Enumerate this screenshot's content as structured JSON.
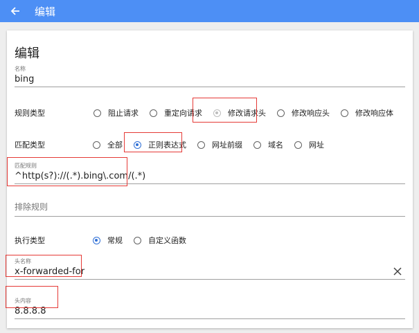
{
  "appbar": {
    "title": "编辑"
  },
  "card": {
    "title": "编辑",
    "name": {
      "label": "名称",
      "value": "bing"
    },
    "rule_type": {
      "label": "规则类型",
      "options": [
        "阻止请求",
        "重定向请求",
        "修改请求头",
        "修改响应头",
        "修改响应体"
      ],
      "selected": "修改请求头"
    },
    "match_type": {
      "label": "匹配类型",
      "options": [
        "全部",
        "正则表达式",
        "网址前缀",
        "域名",
        "网址"
      ],
      "selected": "正则表达式"
    },
    "match_rule": {
      "label": "匹配规则",
      "value": "^http(s?)://(.*).bing\\.com/(.*)"
    },
    "exclude_rule": {
      "placeholder": "排除规则"
    },
    "exec_type": {
      "label": "执行类型",
      "options": [
        "常规",
        "自定义函数"
      ],
      "selected": "常规"
    },
    "header_name": {
      "label": "头名称",
      "value": "x-forwarded-for"
    },
    "header_value": {
      "label": "头内容",
      "value": "8.8.8.8"
    }
  },
  "colors": {
    "appbar": "#4d8ff5",
    "radio_checked": "#2f6fd6",
    "highlight": "#e53935"
  }
}
